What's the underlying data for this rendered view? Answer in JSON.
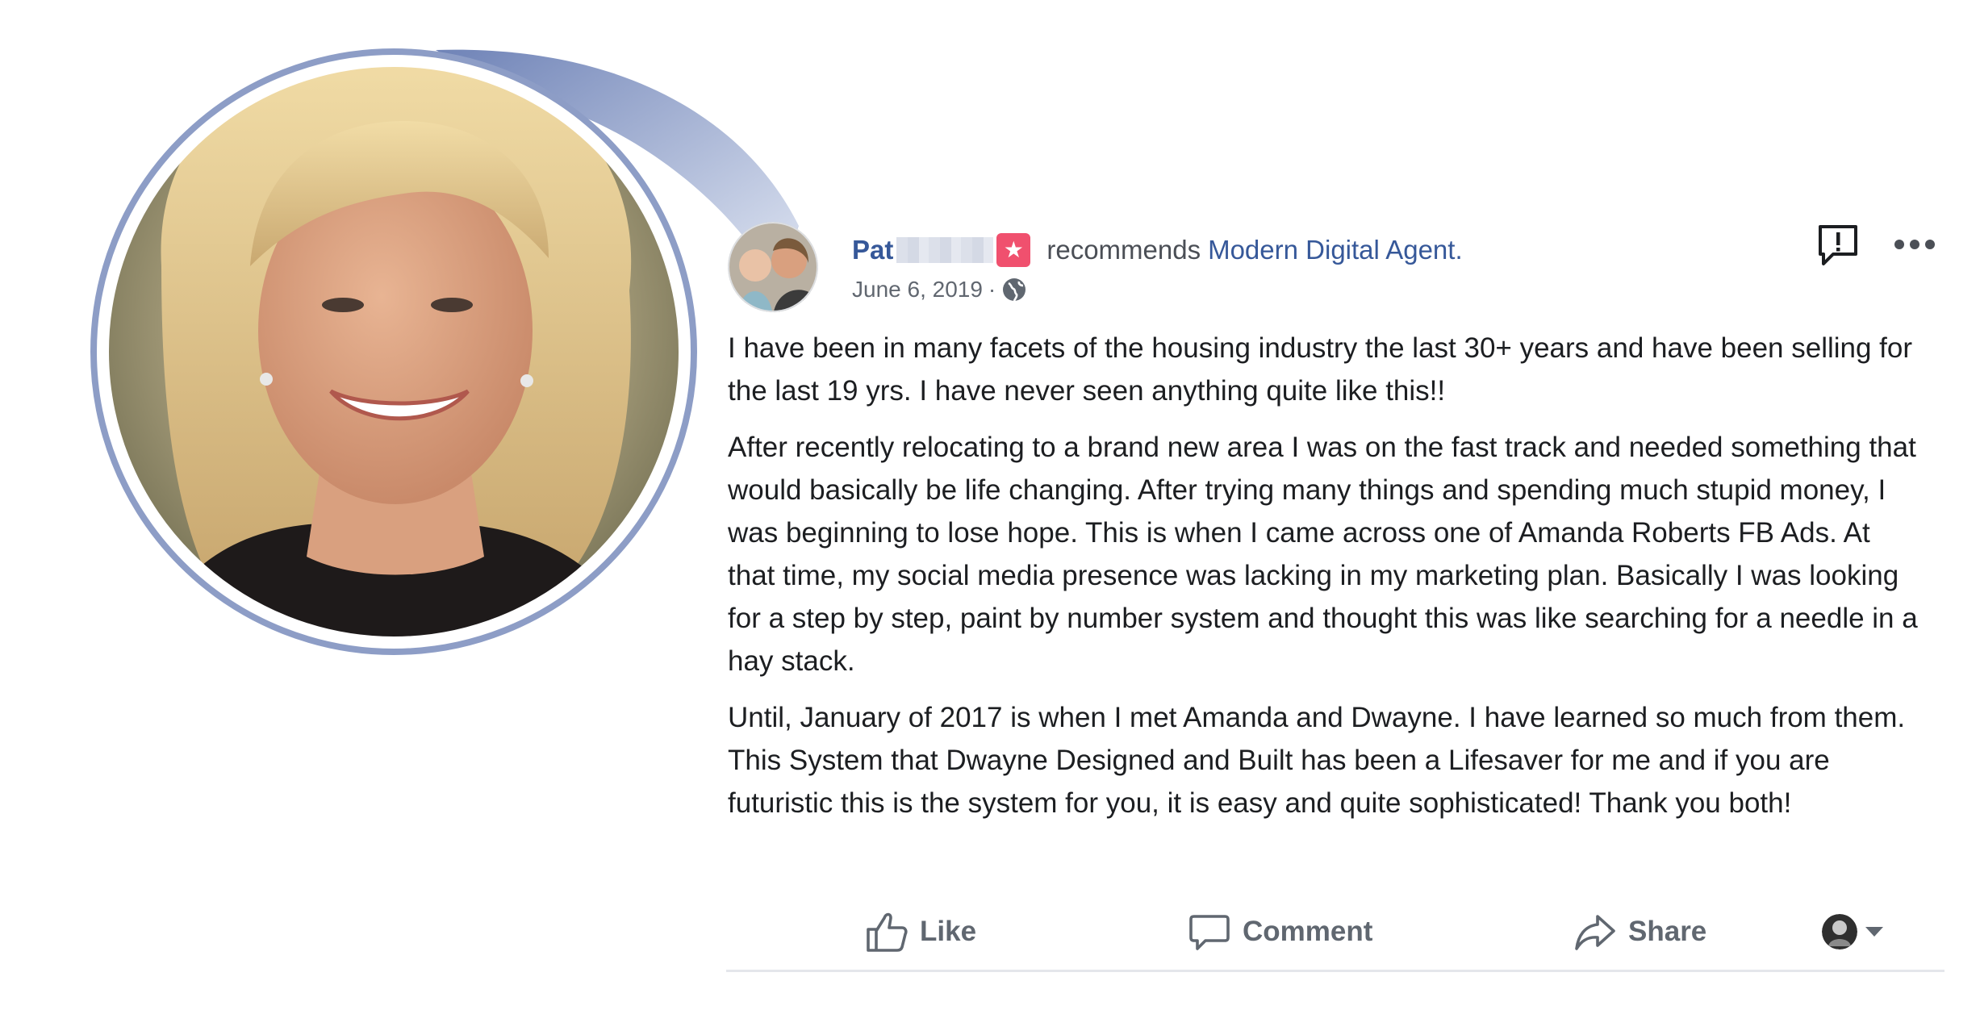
{
  "post": {
    "author": {
      "name": "Pat",
      "badge_icon": "star-badge-icon"
    },
    "recommends_text": "recommends",
    "page_name": "Modern Digital Agent.",
    "date": "June 6, 2019",
    "separator": "·",
    "audience_icon": "globe-icon",
    "body": [
      "I have been in many facets of the housing industry the last 30+ years and have been selling for the last 19 yrs. I have never seen anything quite like this!!",
      "After recently relocating to a brand new area I was on the fast track and needed something that would basically be life changing. After trying many things and spending much stupid money, I was beginning to lose hope. This is when I came across one of Amanda Roberts FB Ads. At that time, my social media presence was lacking in my marketing plan. Basically I was looking for a step by step, paint by number system and thought this was like searching for a needle in a hay stack.",
      "Until, January of 2017 is when I met Amanda and Dwayne. I have learned so much from them. This System that Dwayne Designed and Built has been a Lifesaver for me and if you are futuristic this is the system for you, it is easy and quite sophisticated! Thank you both!"
    ],
    "actions": {
      "like": "Like",
      "comment": "Comment",
      "share": "Share"
    }
  },
  "colors": {
    "link_blue": "#365899",
    "callout_blue": "#8d9dc6",
    "badge_red": "#f0506e",
    "muted_text": "#606770"
  }
}
